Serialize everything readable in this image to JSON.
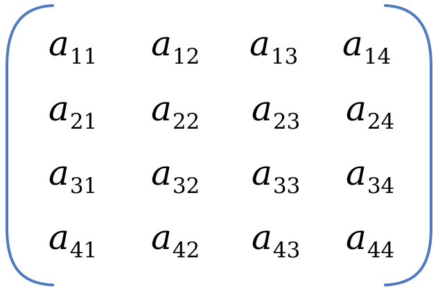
{
  "matrix": {
    "variable": "a",
    "bracket_color": "#4f7abf",
    "rows": [
      [
        "11",
        "12",
        "13",
        "14"
      ],
      [
        "21",
        "22",
        "23",
        "24"
      ],
      [
        "31",
        "32",
        "33",
        "34"
      ],
      [
        "41",
        "42",
        "43",
        "44"
      ]
    ]
  }
}
